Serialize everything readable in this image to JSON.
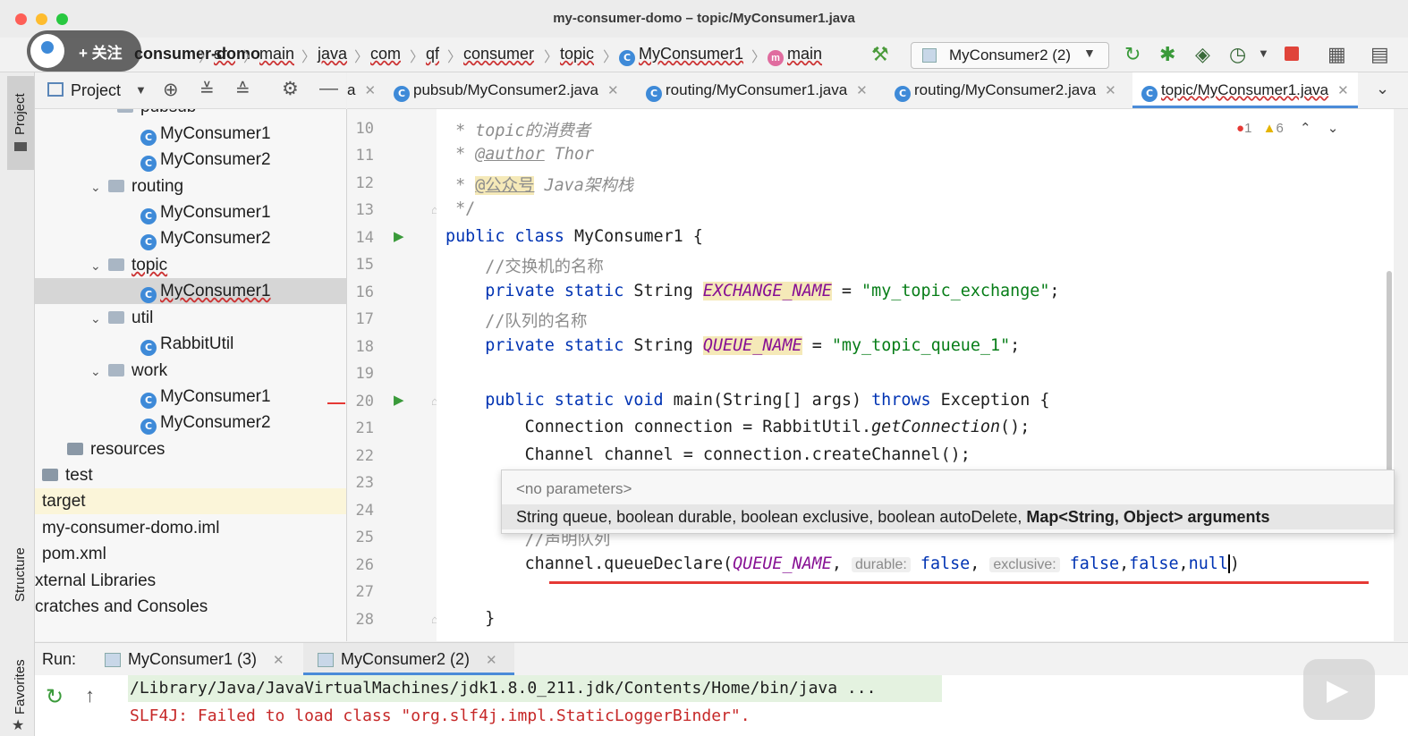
{
  "window": {
    "title": "my-consumer-domo – topic/MyConsumer1.java"
  },
  "overlay": {
    "follow_label": "+ 关注"
  },
  "breadcrumb": {
    "project": "consumer-domo",
    "items": [
      "src",
      "main",
      "java",
      "com",
      "qf",
      "consumer",
      "topic",
      "MyConsumer1",
      "main"
    ]
  },
  "toolbar": {
    "run_config": "MyConsumer2 (2)"
  },
  "sidebar": {
    "project_label": "Project",
    "structure_label": "Structure",
    "favorites_label": "Favorites"
  },
  "project_panel": {
    "title": "Project"
  },
  "tree": {
    "pubsub_label": "pubsub",
    "pubsub_c1": "MyConsumer1",
    "pubsub_c2": "MyConsumer2",
    "routing_label": "routing",
    "routing_c1": "MyConsumer1",
    "routing_c2": "MyConsumer2",
    "topic_label": "topic",
    "topic_c1": "MyConsumer1",
    "util_label": "util",
    "util_c1": "RabbitUtil",
    "work_label": "work",
    "work_c1": "MyConsumer1",
    "work_c2": "MyConsumer2",
    "resources": "resources",
    "test": "test",
    "target": "target",
    "iml": "my-consumer-domo.iml",
    "pom": "pom.xml",
    "ext_libs": "xternal Libraries",
    "scratches": "cratches and Consoles"
  },
  "tabs": {
    "partial": "a",
    "t1": "pubsub/MyConsumer2.java",
    "t2": "routing/MyConsumer1.java",
    "t3": "routing/MyConsumer2.java",
    "t4": "topic/MyConsumer1.java"
  },
  "inspections": {
    "errors": "1",
    "warnings": "6"
  },
  "editor": {
    "line_numbers": [
      "10",
      "11",
      "12",
      "13",
      "14",
      "15",
      "16",
      "17",
      "18",
      "19",
      "20",
      "21",
      "22",
      "23",
      "24",
      "25",
      "26",
      "27",
      "28"
    ],
    "l10_star": " * ",
    "l10_text": "topic的消费者",
    "l11_star": " * ",
    "l11_tag": "@author",
    "l11_text": " Thor",
    "l12_star": " * ",
    "l12_tag": "@公众号",
    "l12_text": " Java架构栈",
    "l13": " */",
    "l14_kw": "public class",
    "l14_rest": " MyConsumer1 {",
    "l15": "    //交换机的名称",
    "l16_kw": "    private static",
    "l16_type": " String ",
    "l16_field": "EXCHANGE_NAME",
    "l16_eq": " = ",
    "l16_str": "\"my_topic_exchange\"",
    "l16_end": ";",
    "l17": "    //队列的名称",
    "l18_kw": "    private static",
    "l18_type": " String ",
    "l18_field": "QUEUE_NAME",
    "l18_eq": " = ",
    "l18_str": "\"my_topic_queue_1\"",
    "l18_end": ";",
    "l20_kw": "    public static void",
    "l20_rest": " main(String[] args) ",
    "l20_kw2": "throws",
    "l20_end": " Exception {",
    "l21_a": "        Connection connection = RabbitUtil.",
    "l21_m": "getConnection",
    "l21_b": "();",
    "l22": "        Channel channel = connection.createChannel();",
    "l25": "        //声明队列",
    "l26_a": "        channel.queueDeclare(",
    "l26_field": "QUEUE_NAME",
    "l26_comma": ", ",
    "l26_hint1": "durable:",
    "l26_v1": " false",
    "l26_c2": ", ",
    "l26_hint2": "exclusive:",
    "l26_v2": " false",
    "l26_c3": ",",
    "l26_v3": "false",
    "l26_c4": ",",
    "l26_v4": "null",
    "l26_end": ")",
    "l28": "    }"
  },
  "param_popup": {
    "line1": "<no parameters>",
    "line2_plain": "String queue, boolean durable, boolean exclusive, boolean autoDelete, ",
    "line2_bold": "Map<String, Object> arguments"
  },
  "run_panel": {
    "label": "Run:",
    "tab1": "MyConsumer1 (3)",
    "tab2": "MyConsumer2 (2)",
    "out1": "/Library/Java/JavaVirtualMachines/jdk1.8.0_211.jdk/Contents/Home/bin/java ...",
    "out2": "SLF4J: Failed to load class \"org.slf4j.impl.StaticLoggerBinder\"."
  },
  "colors": {
    "accent": "#4a8bd8",
    "keyword": "#0033b3",
    "string": "#067d17",
    "field": "#871094",
    "error": "#e53935"
  }
}
